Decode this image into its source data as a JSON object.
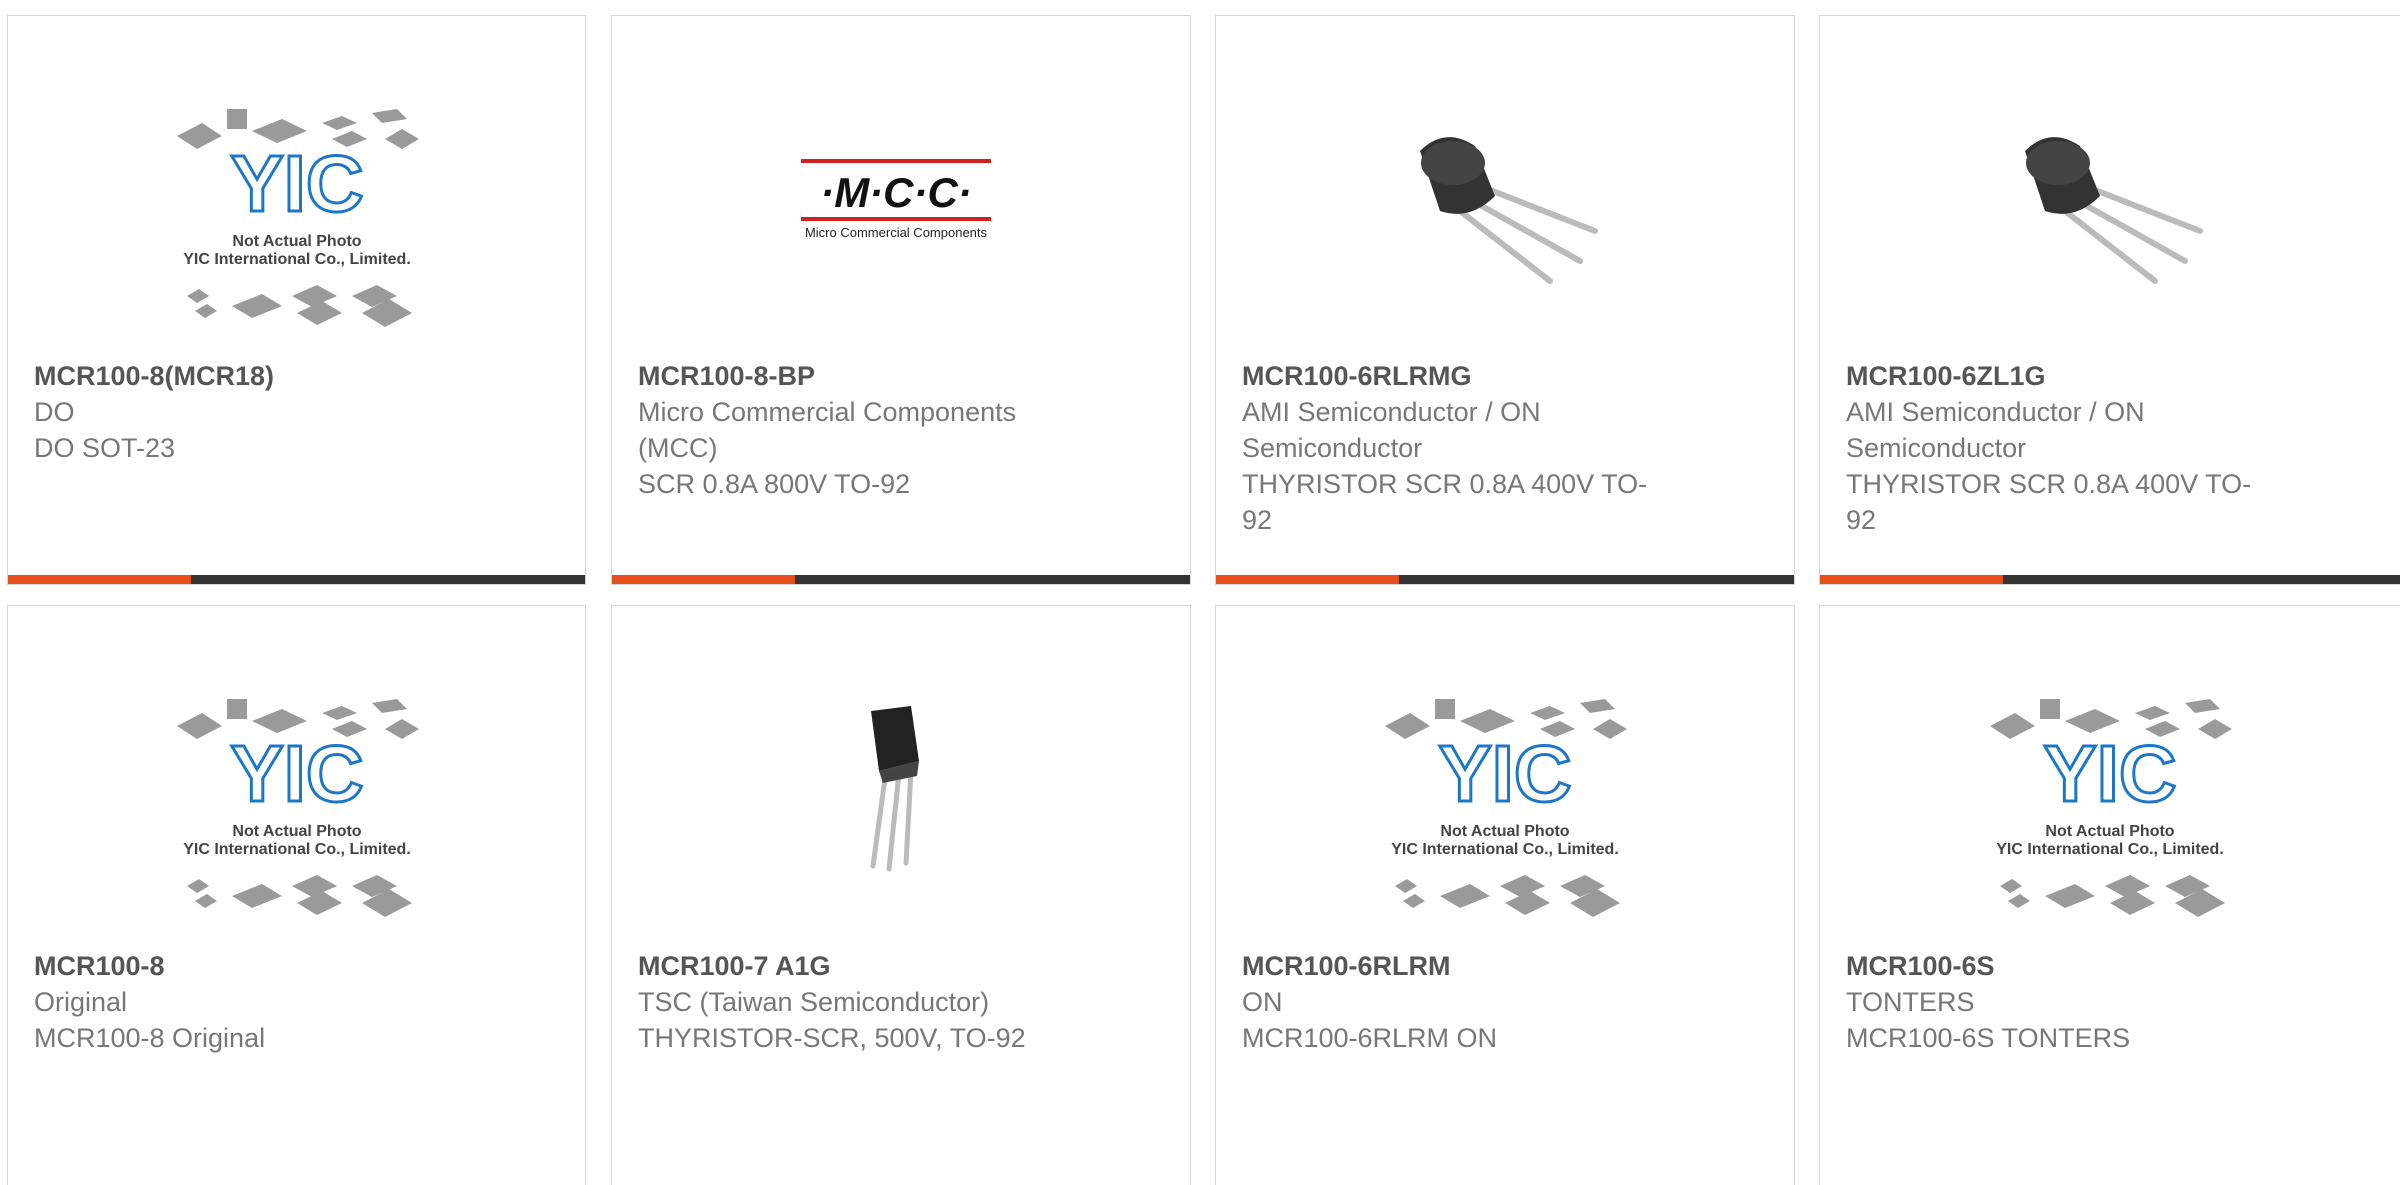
{
  "products": [
    {
      "pn": "MCR100-8(MCR18)",
      "lines": [
        "DO",
        "DO SOT-23"
      ],
      "image": "yic-placeholder",
      "image_text": [
        "Not Actual Photo",
        "YIC International Co., Limited."
      ]
    },
    {
      "pn": "MCR100-8-BP",
      "lines": [
        "Micro Commercial Components (MCC)",
        "SCR 0.8A 800V TO-92"
      ],
      "image": "mcc-logo",
      "image_text": [
        "·M·C·C·",
        "Micro Commercial Components"
      ]
    },
    {
      "pn": "MCR100-6RLRMG",
      "lines": [
        "AMI Semiconductor / ON Semiconductor",
        "THYRISTOR SCR 0.8A 400V TO-92"
      ],
      "image": "to92-photo"
    },
    {
      "pn": "MCR100-6ZL1G",
      "lines": [
        "AMI Semiconductor / ON Semiconductor",
        "THYRISTOR SCR 0.8A 400V TO-92"
      ],
      "image": "to92-photo"
    },
    {
      "pn": "MCR100-8",
      "lines": [
        "Original",
        "MCR100-8 Original"
      ],
      "image": "yic-placeholder",
      "image_text": [
        "Not Actual Photo",
        "YIC International Co., Limited."
      ]
    },
    {
      "pn": "MCR100-7 A1G",
      "lines": [
        "TSC (Taiwan Semiconductor)",
        "THYRISTOR-SCR, 500V, TO-92"
      ],
      "image": "to92-upright-photo"
    },
    {
      "pn": "MCR100-6RLRM",
      "lines": [
        "ON",
        "MCR100-6RLRM ON"
      ],
      "image": "yic-placeholder",
      "image_text": [
        "Not Actual Photo",
        "YIC International Co., Limited."
      ]
    },
    {
      "pn": "MCR100-6S",
      "lines": [
        "TONTERS",
        "MCR100-6S TONTERS"
      ],
      "image": "yic-placeholder",
      "image_text": [
        "Not Actual Photo",
        "YIC International Co., Limited."
      ]
    }
  ],
  "colors": {
    "accent": "#e84e1b",
    "bar": "#333333",
    "border": "#d6d6d6",
    "mcc_red": "#d0211b"
  }
}
